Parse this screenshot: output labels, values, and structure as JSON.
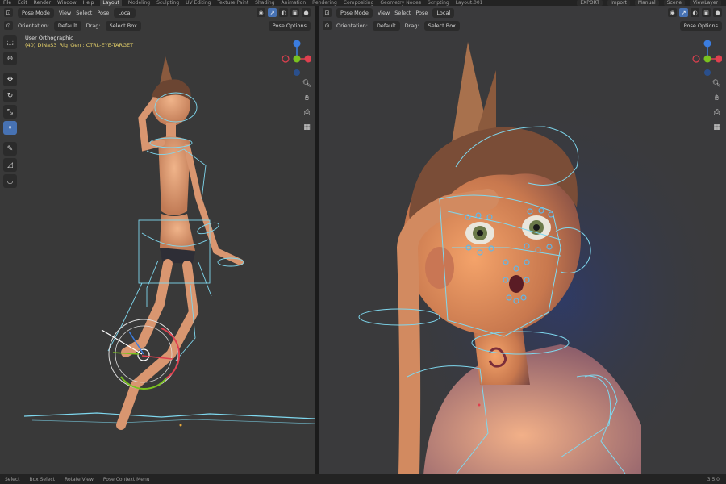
{
  "topbar": {
    "menus": [
      "File",
      "Edit",
      "Render",
      "Window",
      "Help"
    ],
    "workspaces": [
      "Layout",
      "Modeling",
      "Sculpting",
      "UV Editing",
      "Texture Paint",
      "Shading",
      "Animation",
      "Rendering",
      "Compositing",
      "Geometry Nodes",
      "Scripting",
      "Layout.001"
    ],
    "active_workspace": "Layout",
    "right": [
      "EXPORT",
      "Import",
      "Manual",
      "Scene",
      "ViewLayer"
    ]
  },
  "left_view": {
    "mode": "Pose Mode",
    "menus": [
      "View",
      "Select",
      "Pose"
    ],
    "transform": "Local",
    "orientation_label": "Orientation:",
    "orientation": "Default",
    "drag_label": "Drag:",
    "drag": "Select Box",
    "pose_options": "Pose Options",
    "view_name": "User Orthographic",
    "object_info": "(40) DiNaS3_Rig_Gen : CTRL-EYE-TARGET"
  },
  "right_view": {
    "mode": "Pose Mode",
    "menus": [
      "View",
      "Select",
      "Pose"
    ],
    "transform": "Local",
    "orientation_label": "Orientation:",
    "orientation": "Default",
    "drag_label": "Drag:",
    "drag": "Select Box",
    "pose_options": "Pose Options"
  },
  "gizmo": {
    "x_color": "#e0404f",
    "y_color": "#7ac21f",
    "z_color": "#3b7de0"
  },
  "statusbar": [
    "Select",
    "Box Select",
    "Rotate View",
    "Pose Context Menu"
  ],
  "version": "3.5.0",
  "colors": {
    "accent": "#4772b3",
    "rig": "#7fd8ef",
    "viewport_bg": "#393939"
  }
}
